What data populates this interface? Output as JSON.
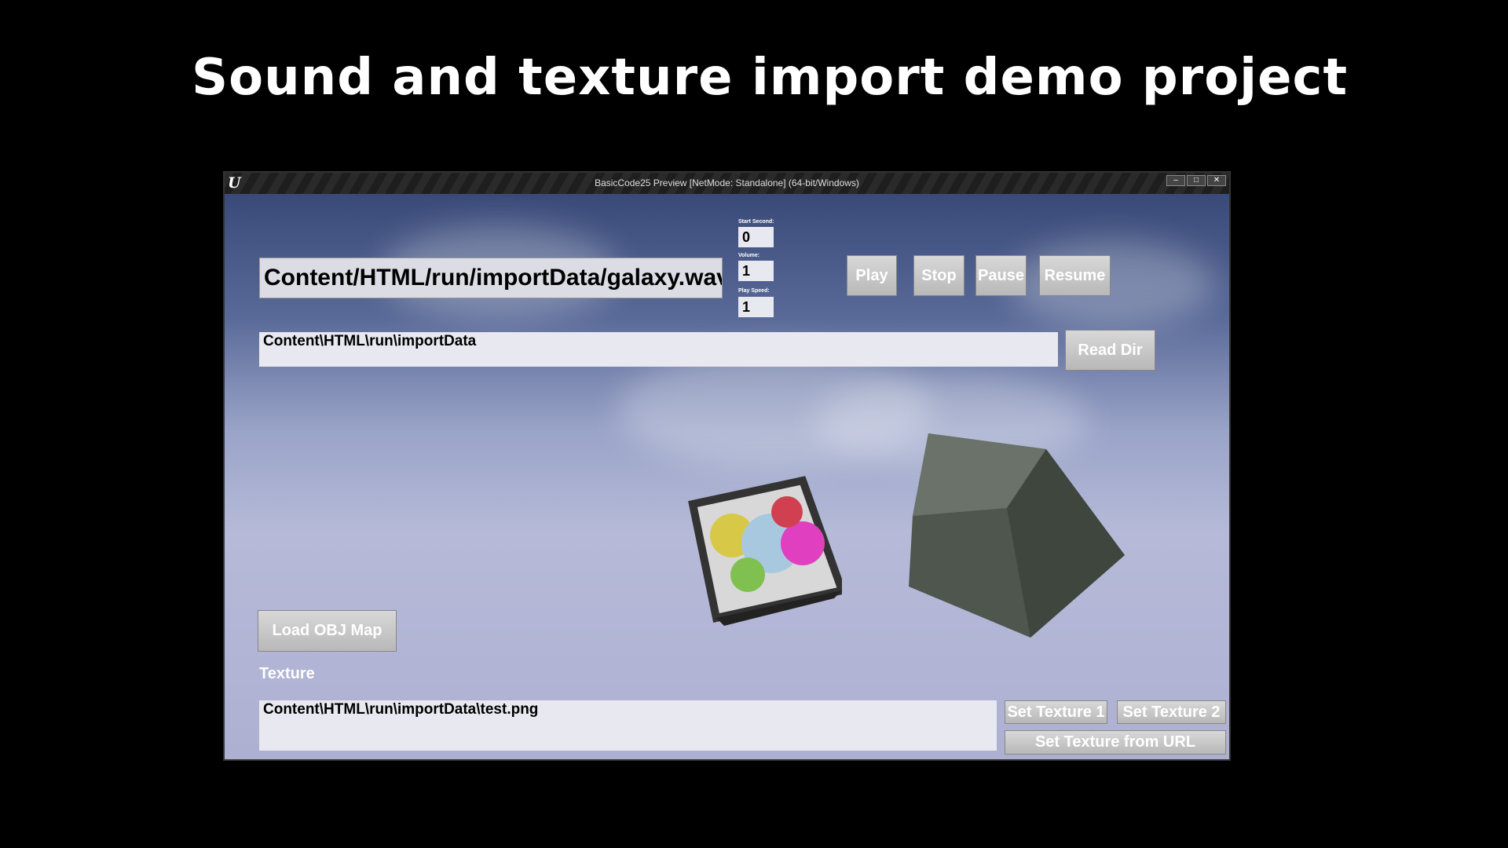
{
  "slide_title": "Sound and texture import demo project",
  "window": {
    "title": "BasicCode25 Preview [NetMode: Standalone] (64-bit/Windows)",
    "logo": "U",
    "controls": [
      "minimize",
      "maximize",
      "close"
    ]
  },
  "audio": {
    "file_path": "Content/HTML/run/importData/galaxy.wav",
    "start_second_label": "Start Second:",
    "start_second": "0",
    "volume_label": "Volume:",
    "volume": "1",
    "play_speed_label": "Play Speed:",
    "play_speed": "1",
    "play": "Play",
    "stop": "Stop",
    "pause": "Pause",
    "resume": "Resume"
  },
  "directory": {
    "path": "Content\\HTML\\run\\importData",
    "read_dir": "Read Dir"
  },
  "load_obj": "Load OBJ Map",
  "texture": {
    "label": "Texture",
    "path": "Content\\HTML\\run\\importData\\test.png",
    "set1": "Set Texture 1",
    "set2": "Set Texture 2",
    "set_url": "Set Texture from URL"
  }
}
